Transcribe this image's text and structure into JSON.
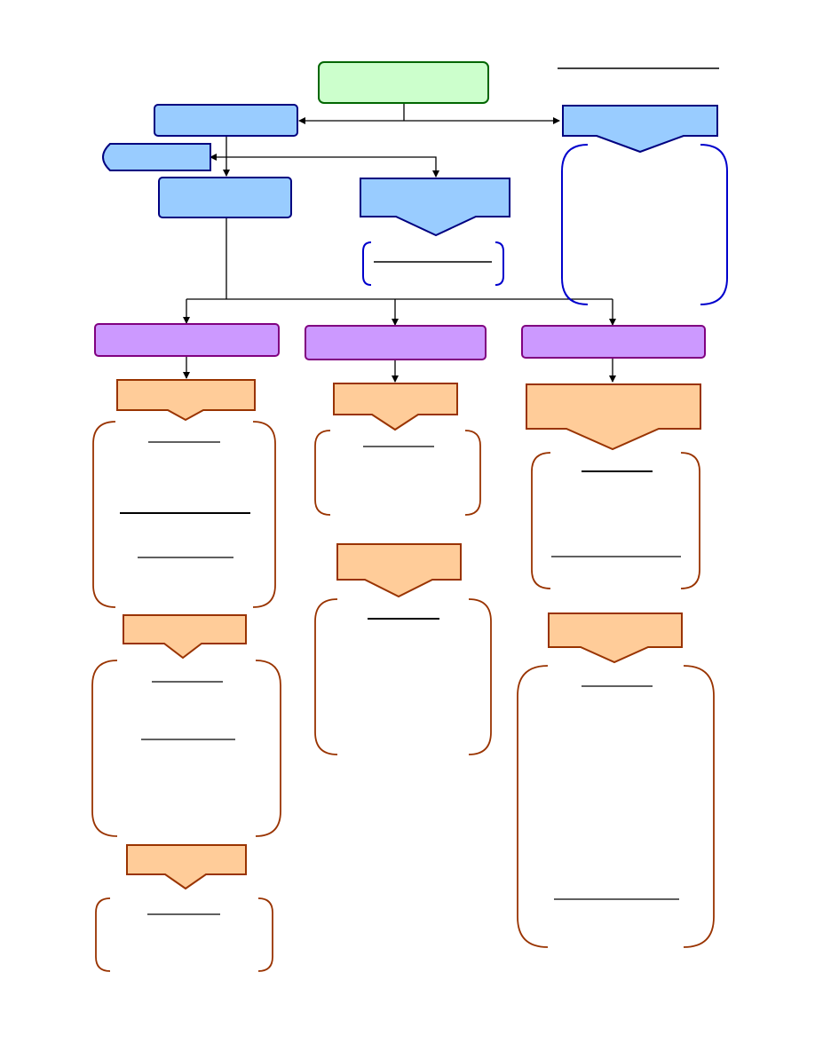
{
  "diagram": {
    "title": "",
    "colors": {
      "root_fill": "#ccffcc",
      "root_stroke": "#006600",
      "blue_fill": "#99ccff",
      "blue_stroke": "#000080",
      "blue_bracket": "#0000cc",
      "purple_fill": "#cc99ff",
      "purple_stroke": "#800080",
      "orange_fill": "#ffcc99",
      "orange_stroke": "#993300",
      "brown_bracket": "#993300",
      "line": "#000000"
    },
    "nodes": {
      "root": {
        "label": ""
      },
      "left_main": {
        "label": ""
      },
      "left_side_pill": {
        "label": ""
      },
      "left_child": {
        "label": ""
      },
      "center_arrow_box": {
        "label": ""
      },
      "right_arrow_box": {
        "label": ""
      },
      "purple_left": {
        "label": ""
      },
      "purple_center": {
        "label": ""
      },
      "purple_right": {
        "label": ""
      },
      "orange_l1": {
        "label": ""
      },
      "orange_l2": {
        "label": ""
      },
      "orange_l3": {
        "label": ""
      },
      "orange_c1": {
        "label": ""
      },
      "orange_c2": {
        "label": ""
      },
      "orange_r1": {
        "label": ""
      },
      "orange_r2": {
        "label": ""
      }
    },
    "brackets": {
      "right_blue": {
        "text": ""
      },
      "center_blue": {
        "text": ""
      },
      "l1": {
        "text": ""
      },
      "l2": {
        "text": ""
      },
      "l3": {
        "text": ""
      },
      "c1": {
        "text": ""
      },
      "c2": {
        "text": ""
      },
      "r1": {
        "text": ""
      },
      "r2": {
        "text": ""
      }
    }
  }
}
